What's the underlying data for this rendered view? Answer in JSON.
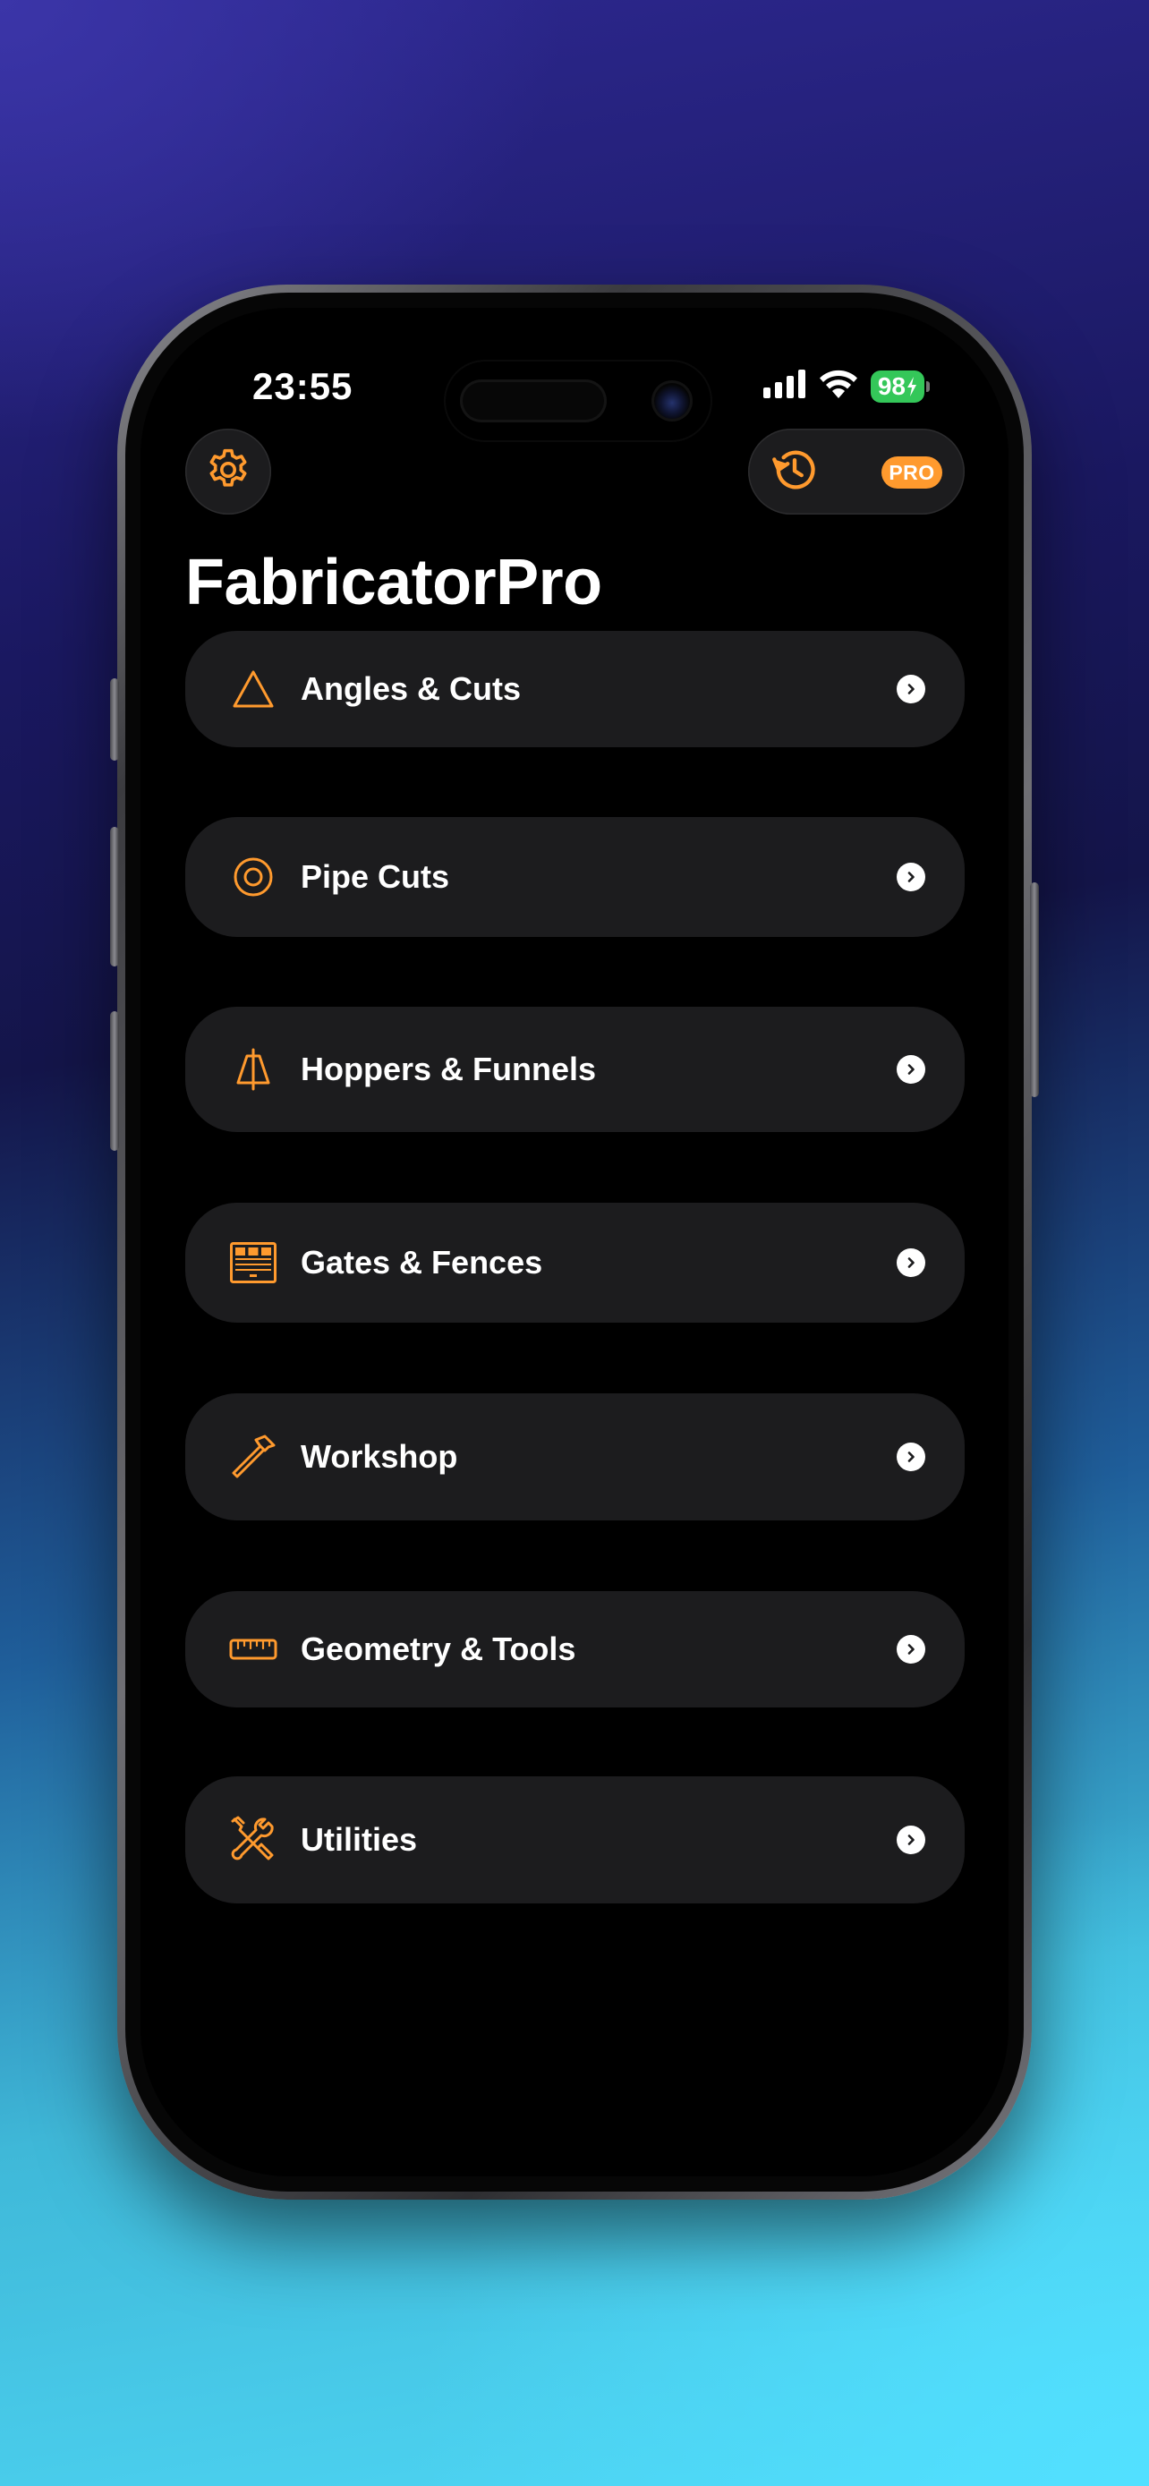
{
  "status_bar": {
    "time": "23:55",
    "battery_level": "98",
    "battery_color": "#34c759"
  },
  "header": {
    "settings_icon": "gear-icon",
    "history_icon": "history-icon",
    "pro_badge": "PRO",
    "title": "FabricatorPro"
  },
  "accent_color": "#ff9a2e",
  "menu": {
    "items": [
      {
        "label": "Angles & Cuts",
        "icon": "triangle-icon"
      },
      {
        "label": "Pipe Cuts",
        "icon": "pipe-ring-icon"
      },
      {
        "label": "Hoppers & Funnels",
        "icon": "funnel-icon"
      },
      {
        "label": "Gates & Fences",
        "icon": "gate-icon"
      },
      {
        "label": "Workshop",
        "icon": "hammer-icon"
      },
      {
        "label": "Geometry & Tools",
        "icon": "ruler-icon"
      },
      {
        "label": "Utilities",
        "icon": "tools-icon"
      }
    ]
  }
}
